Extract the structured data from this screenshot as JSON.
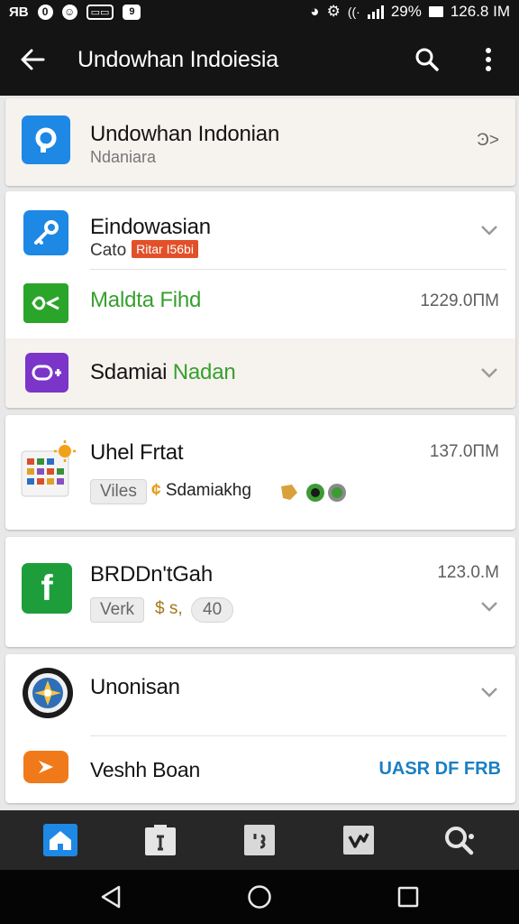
{
  "status_bar": {
    "left_text": "ЯB",
    "right_text": "29%",
    "time": "126.8 IM",
    "icons": [
      "notification-badge-icon",
      "chat-icon",
      "cast-icon",
      "app-badge-icon",
      "clock-icon",
      "gear-icon",
      "wifi-icon",
      "signal-icon",
      "battery-icon"
    ]
  },
  "app_bar": {
    "title": "Undowhan Indoiesia",
    "icons": [
      "back-arrow-icon",
      "search-icon",
      "more-vert-icon"
    ]
  },
  "colors": {
    "app_bar_bg": "#141414",
    "accent_blue": "#1e88e5",
    "green_text": "#36a02e",
    "tag_red": "#e2502a",
    "link_blue": "#1a7fc4"
  },
  "items": [
    {
      "title": "Undowhan Indonian",
      "subtitle": "Ndaniara",
      "trailing": "Ͽ>",
      "icon": "blue-p-app-icon"
    },
    {
      "title": "Eindowasian",
      "subtitle": "Cato",
      "tag": "Ritar I56bi",
      "icon": "blue-key-app-icon",
      "expand": true
    },
    {
      "title_a": "Maldta",
      "title_b": "Fihd",
      "size": "1229.0ΠM",
      "icon": "green-chat-app-icon"
    },
    {
      "title_a": "Sdamiai",
      "title_b": "Nadan",
      "icon": "purple-toggle-app-icon",
      "expand": true
    },
    {
      "title": "Uhel Frtat",
      "size": "137.0ΠM",
      "chip": "Viles",
      "detail": "Sdamiakhg",
      "icon": "grid-sun-app-icon"
    },
    {
      "title": "BRDDn'tGah",
      "size": "123.0.M",
      "chip": "Verk",
      "detail": "$ s,",
      "chip2": "40",
      "icon": "facebook-app-icon",
      "expand": true
    },
    {
      "title": "Unonisan",
      "icon": "badge-emblem-app-icon",
      "expand": true
    },
    {
      "title": "Veshh Boan",
      "action": "UASR DF FRB",
      "icon": "orange-play-app-icon"
    }
  ],
  "bottom_nav": [
    "home-icon",
    "clipboard-icon",
    "quote-icon",
    "check-icon",
    "search-settings-icon"
  ],
  "system_nav": [
    "back-icon",
    "home-circle-icon",
    "recents-icon"
  ]
}
